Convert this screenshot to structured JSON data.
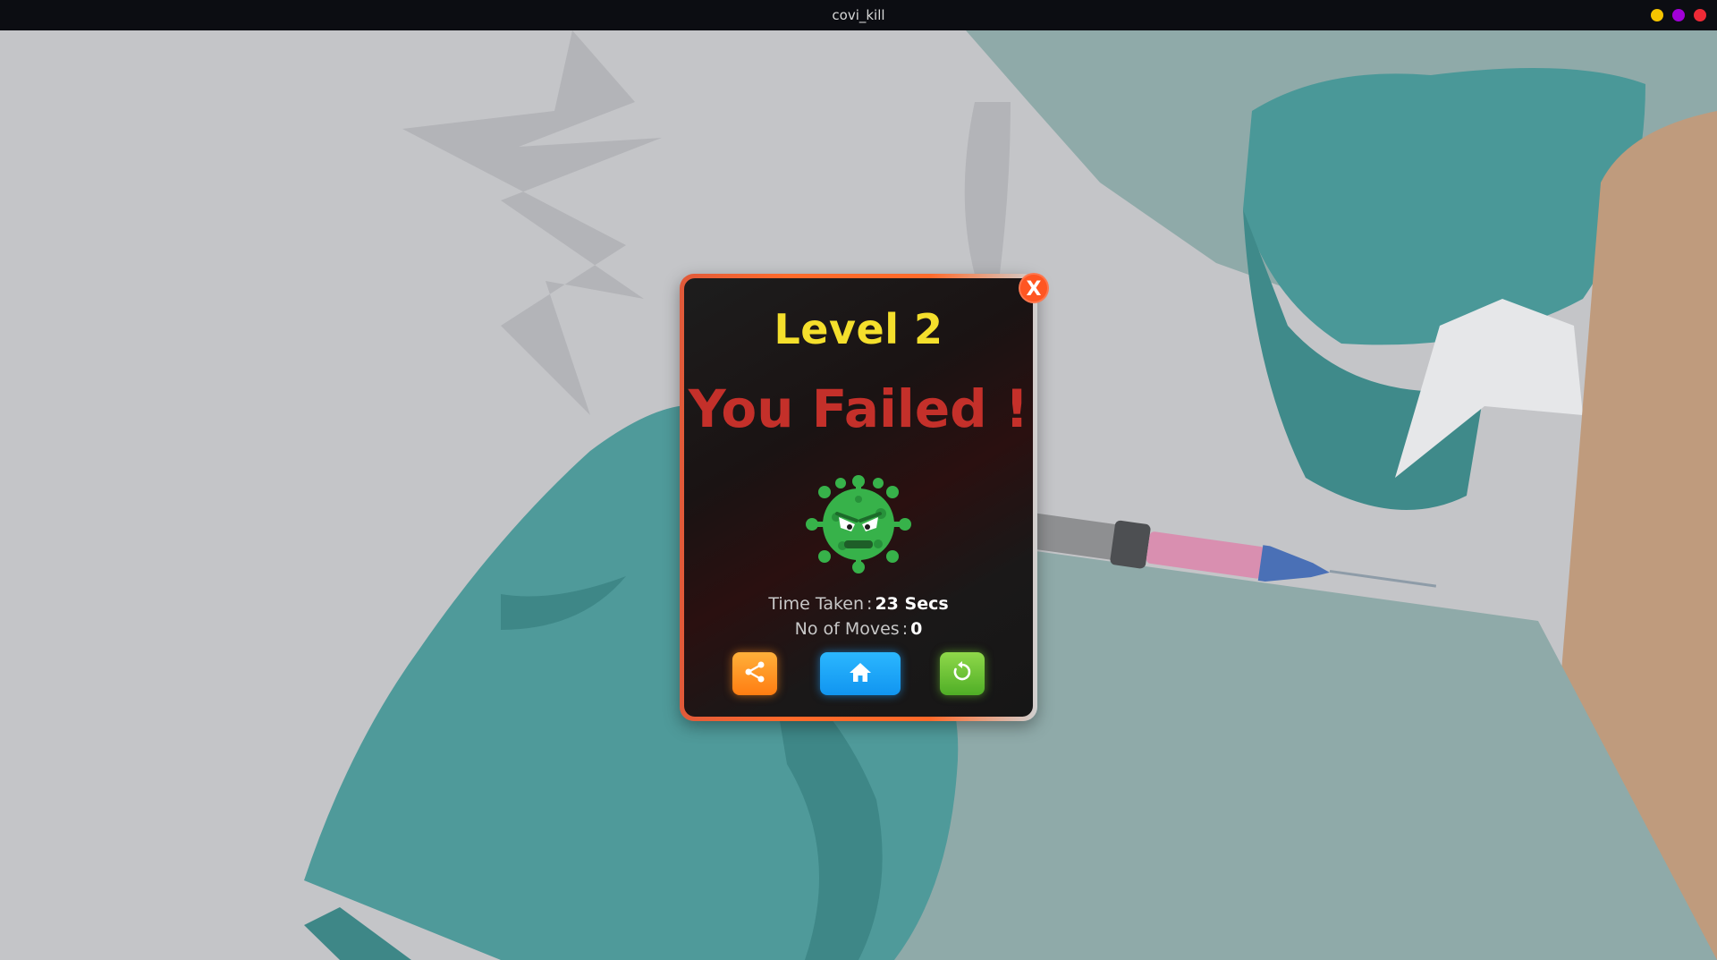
{
  "window": {
    "title": "covi_kill",
    "controls": [
      {
        "name": "minimize",
        "color": "#f5c400"
      },
      {
        "name": "maximize",
        "color": "#a100d8"
      },
      {
        "name": "close",
        "color": "#ee2a36"
      }
    ]
  },
  "dialog": {
    "close_label": "X",
    "level": "Level 2",
    "result": "You Failed !",
    "mascot_icon": "angry-virus-icon",
    "stats": {
      "time_label": "Time Taken",
      "time_value": "23 Secs",
      "moves_label": "No of Moves",
      "moves_value": "0",
      "separator": ":"
    },
    "buttons": {
      "share_icon": "share-icon",
      "home_icon": "home-icon",
      "restart_icon": "restart-icon"
    },
    "colors": {
      "level": "#f4df2c",
      "result": "#c4302a",
      "border": "#ff6a2a"
    }
  }
}
